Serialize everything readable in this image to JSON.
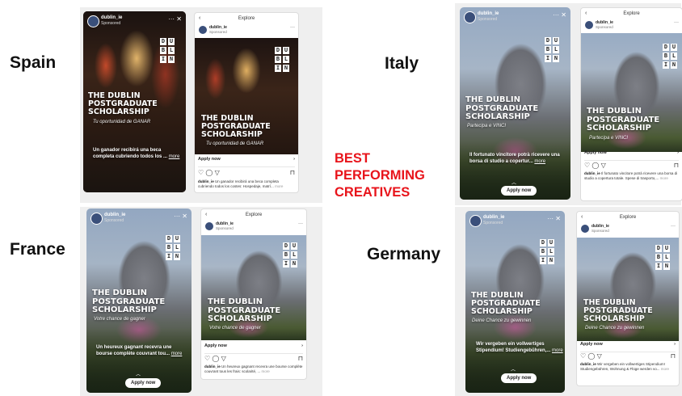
{
  "labels": {
    "spain": "Spain",
    "italy": "Italy",
    "france": "France",
    "germany": "Germany",
    "best_line1": "BEST",
    "best_line2": "PERFORMING",
    "best_line3": "CREATIVES"
  },
  "common": {
    "username": "dublin_ie",
    "sponsored": "Sponsored",
    "explore": "Explore",
    "apply_now": "Apply now",
    "logo_letters": [
      "D",
      "U",
      "B",
      "L",
      "I",
      "N"
    ],
    "title_line1": "THE DUBLIN",
    "title_line2": "POSTGRADUATE",
    "title_line3": "SCHOLARSHIP",
    "more": "more"
  },
  "spain": {
    "subtitle": "Tu oportunidad de GANAR",
    "story_caption": "Un ganador recibirá una beca completa cubriendo todos los ...",
    "feed_caption": "Un ganador recibirá una beca completa cubriendo todos los costes: Hospedaje, matrí..."
  },
  "italy": {
    "subtitle": "Partecipa e VINCI",
    "story_caption": "Il fortunato vincitore potrà ricevere una borsa di studio a copertur...",
    "feed_caption": "Il fortunato vincitore potrà ricevere una borsa di studio a copertura totale. Spese di trasporto,..."
  },
  "france": {
    "subtitle": "Votre chance de gagner",
    "story_caption": "Un heureux gagnant recevra une bourse complète couvrant tou...",
    "feed_caption": "Un heureux gagnant recevra une bourse complète couvrant tous les frais: scolarité, ..."
  },
  "germany": {
    "subtitle": "Deine Chance zu gewinnen",
    "story_caption": "Wir vergeben ein vollwertiges Stipendium! Studiengebühren,...",
    "feed_caption": "Wir vergeben ein vollwertiges Stipendium! Studiengebühren, Wohnung & Flüge werden vo..."
  },
  "colors": {
    "accent_red": "#e8141b",
    "panel_bg": "#efefef"
  },
  "icons": [
    "heart-icon",
    "comment-icon",
    "send-icon",
    "bookmark-icon",
    "back-arrow-icon",
    "close-icon",
    "more-dots-icon",
    "chevron-right-icon"
  ]
}
